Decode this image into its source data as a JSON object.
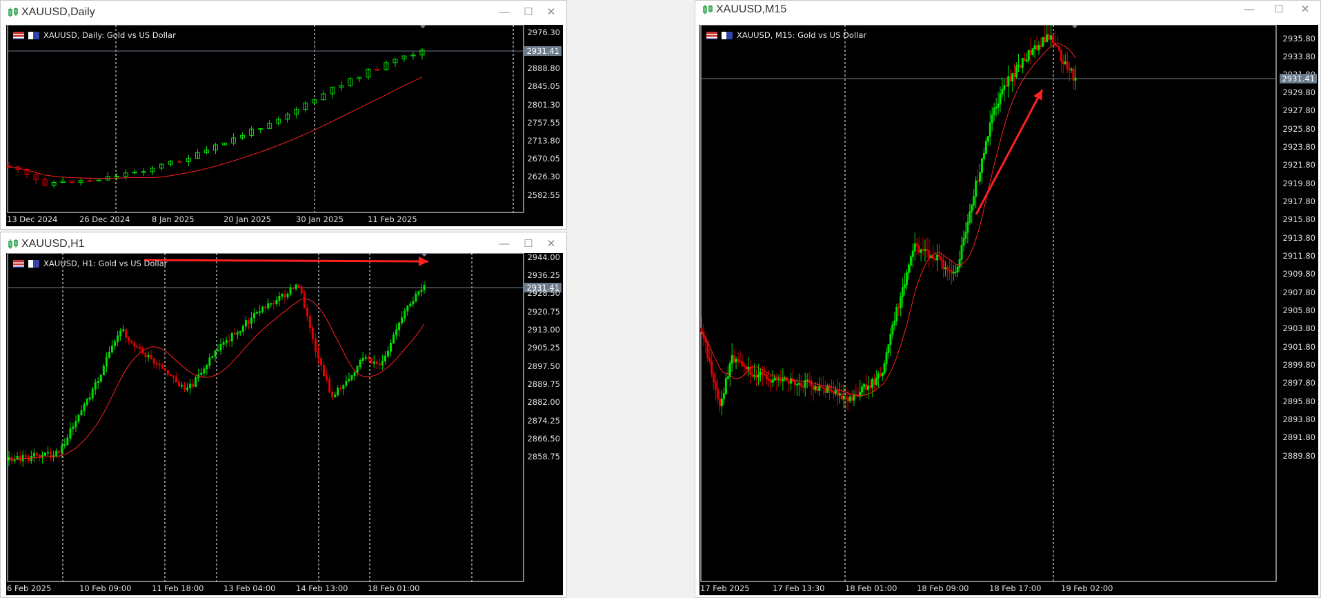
{
  "windows": [
    {
      "id": "daily",
      "title": "XAUUSD,Daily",
      "caption": "XAUUSD, Daily:  Gold vs US Dollar",
      "price_labels": [
        "2976.30",
        "2931.41",
        "2888.80",
        "2845.05",
        "2801.30",
        "2757.55",
        "2713.80",
        "2670.05",
        "2626.30",
        "2582.55"
      ],
      "current_price": "2931.41",
      "time_labels": [
        "13 Dec 2024",
        "26 Dec 2024",
        "8 Jan 2025",
        "20 Jan 2025",
        "30 Jan 2025",
        "11 Feb 2025"
      ]
    },
    {
      "id": "h1",
      "title": "XAUUSD,H1",
      "caption": "XAUUSD, H1:  Gold vs US Dollar",
      "price_labels": [
        "2944.00",
        "2936.25",
        "2931.41",
        "2928.50",
        "2920.75",
        "2913.00",
        "2905.25",
        "2897.50",
        "2889.75",
        "2882.00",
        "2874.25",
        "2866.50",
        "2858.75"
      ],
      "current_price": "2931.41",
      "time_labels": [
        "6 Feb 2025",
        "10 Feb 09:00",
        "11 Feb 18:00",
        "13 Feb 04:00",
        "14 Feb 13:00",
        "18 Feb 01:00"
      ]
    },
    {
      "id": "m15",
      "title": "XAUUSD,M15",
      "caption": "XAUUSD, M15:  Gold vs US Dollar",
      "price_labels": [
        "2935.80",
        "2933.80",
        "2931.80",
        "2931.41",
        "2929.80",
        "2927.80",
        "2925.80",
        "2923.80",
        "2921.80",
        "2919.80",
        "2917.80",
        "2915.80",
        "2913.80",
        "2911.80",
        "2909.80",
        "2907.80",
        "2905.80",
        "2903.80",
        "2901.80",
        "2899.80",
        "2897.80",
        "2895.80",
        "2893.80",
        "2891.80",
        "2889.80"
      ],
      "current_price": "2931.41",
      "time_labels": [
        "17 Feb 2025",
        "17 Feb 13:30",
        "18 Feb 01:00",
        "18 Feb 09:00",
        "18 Feb 17:00",
        "19 Feb 02:00"
      ]
    }
  ],
  "window_controls": {
    "minimize": "—",
    "maximize": "☐",
    "close": "✕"
  },
  "colors": {
    "bull": "#00e000",
    "bear": "#e00000",
    "ma": "#ff2020",
    "grid": "#ffffff",
    "price_line": "#6b7b8c",
    "arrow": "#ff2020"
  }
}
